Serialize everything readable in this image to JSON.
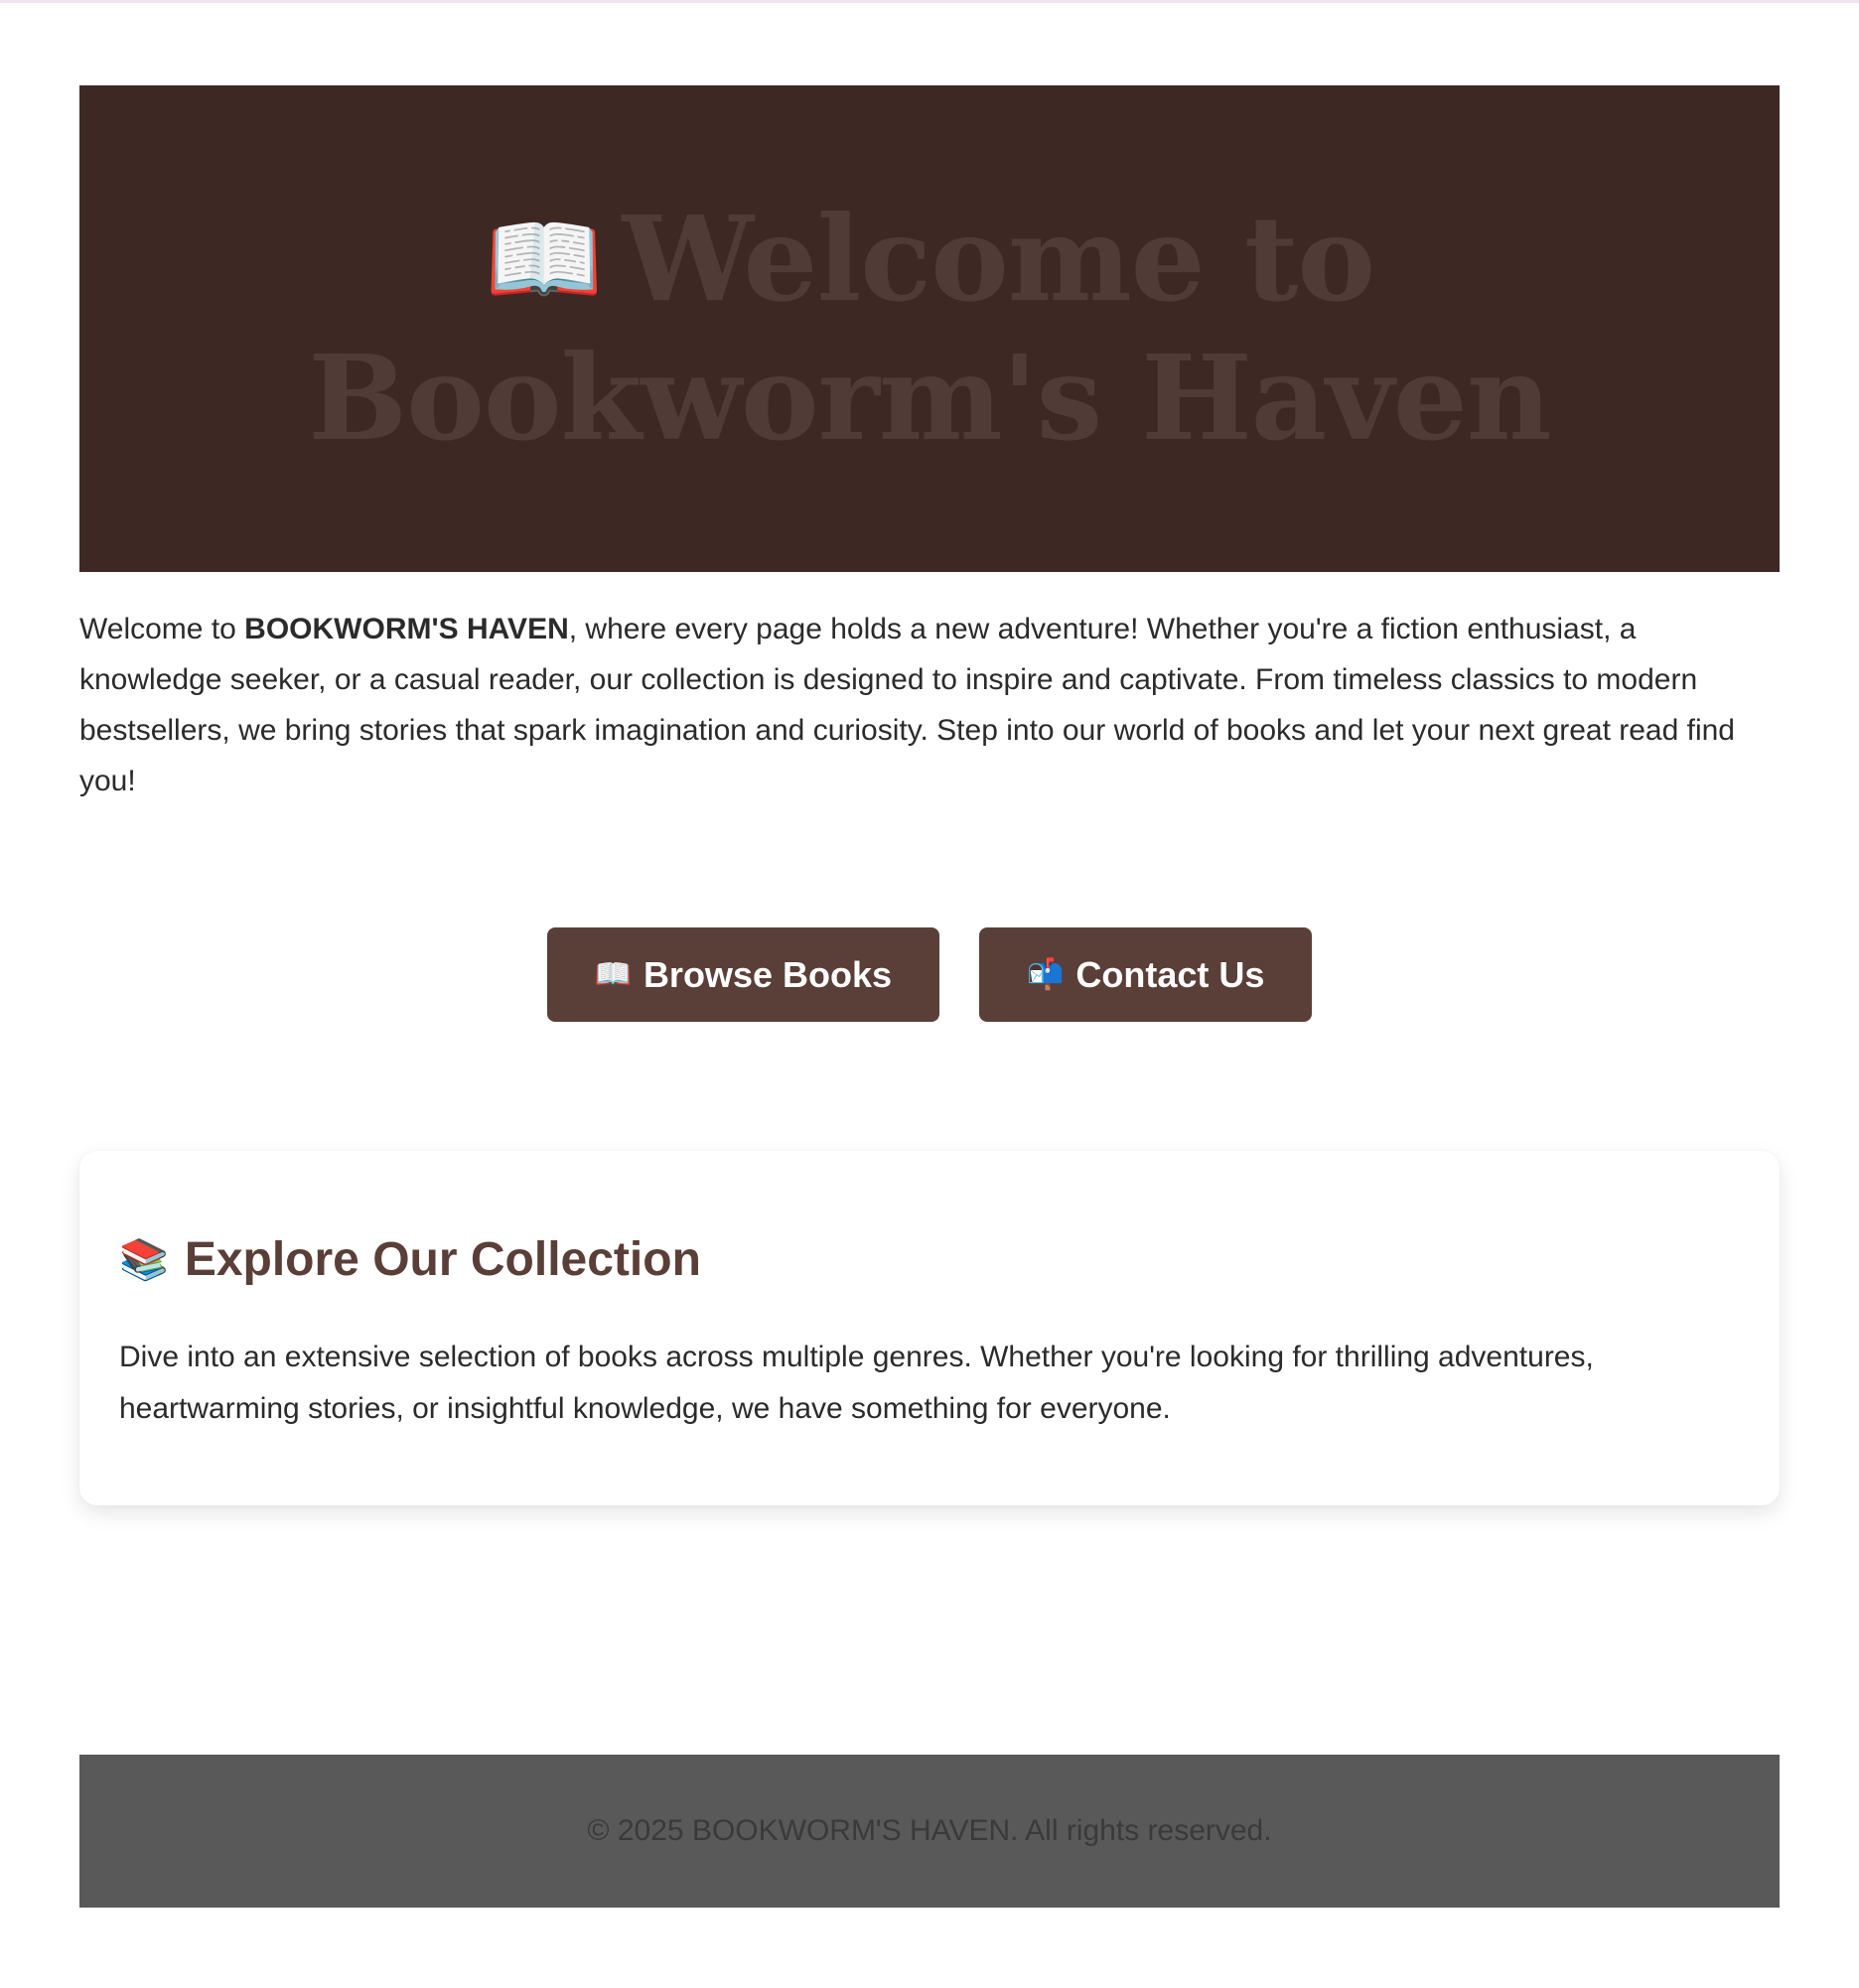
{
  "hero": {
    "icon": "open-book-icon",
    "icon_glyph": "📖",
    "title": "Welcome to Bookworm's Haven",
    "background": "#3d2824",
    "title_color": "#513b36"
  },
  "intro": {
    "prefix": "Welcome to ",
    "brand": "BOOKWORM'S HAVEN",
    "suffix": ", where every page holds a new adventure! Whether you're a fiction enthusiast, a knowledge seeker, or a casual reader, our collection is designed to inspire and captivate. From timeless classics to modern bestsellers, we bring stories that spark imagination and curiosity. Step into our world of books and let your next great read find you!"
  },
  "cta": {
    "browse": {
      "icon": "open-book-icon",
      "icon_glyph": "📖",
      "label": "Browse Books"
    },
    "contact": {
      "icon": "mailbox-icon",
      "icon_glyph": "📬",
      "label": "Contact Us"
    },
    "button_color": "#5a3f38"
  },
  "collection": {
    "icon": "stacked-books-icon",
    "icon_glyph": "📚",
    "title": "Explore Our Collection",
    "body": "Dive into an extensive selection of books across multiple genres. Whether you're looking for thrilling adventures, heartwarming stories, or insightful knowledge, we have something for everyone."
  },
  "footer": {
    "text": "© 2025 BOOKWORM'S HAVEN. All rights reserved.",
    "background": "#595959"
  }
}
